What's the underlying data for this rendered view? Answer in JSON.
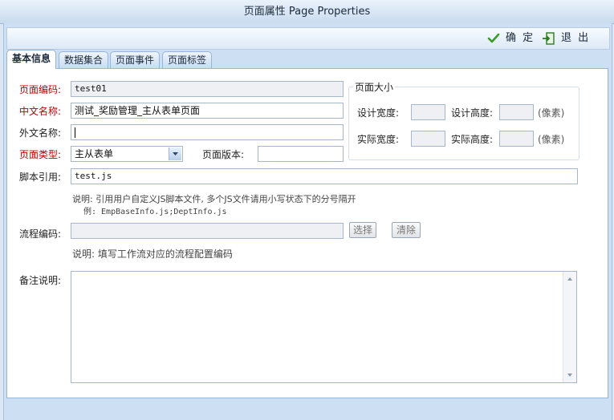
{
  "window": {
    "title": "页面属性  Page Properties"
  },
  "toolbar": {
    "ok_label": "确 定",
    "exit_label": "退 出"
  },
  "tabs": [
    {
      "label": "基本信息",
      "active": true
    },
    {
      "label": "数据集合",
      "active": false
    },
    {
      "label": "页面事件",
      "active": false
    },
    {
      "label": "页面标签",
      "active": false
    }
  ],
  "form": {
    "page_code": {
      "label": "页面编码:",
      "value": "test01"
    },
    "cn_name": {
      "label": "中文名称:",
      "value": "测试_奖励管理_主从表单页面"
    },
    "foreign_name": {
      "label": "外文名称:",
      "value": ""
    },
    "page_type": {
      "label": "页面类型:",
      "value": "主从表单"
    },
    "page_version": {
      "label": "页面版本:",
      "value": ""
    },
    "script_ref": {
      "label": "脚本引用:",
      "value": "test.js"
    },
    "script_note_1": "说明: 引用用户自定义JS脚本文件, 多个JS文件请用小写状态下的分号隔开",
    "script_note_2": "例: EmpBaseInfo.js;DeptInfo.js",
    "flow_code": {
      "label": "流程编码:",
      "value": ""
    },
    "select_button": "选择",
    "clear_button": "清除",
    "flow_note": "说明: 填写工作流对应的流程配置编码",
    "remarks": {
      "label": "备注说明:",
      "value": ""
    }
  },
  "page_size": {
    "legend": "页面大小",
    "design_width_label": "设计宽度:",
    "design_height_label": "设计高度:",
    "actual_width_label": "实际宽度:",
    "actual_height_label": "实际高度:",
    "unit": "(像素)",
    "design_width": "",
    "design_height": "",
    "actual_width": "",
    "actual_height": ""
  },
  "colors": {
    "required_label": "#c00000",
    "accent": "#98b4d6"
  }
}
